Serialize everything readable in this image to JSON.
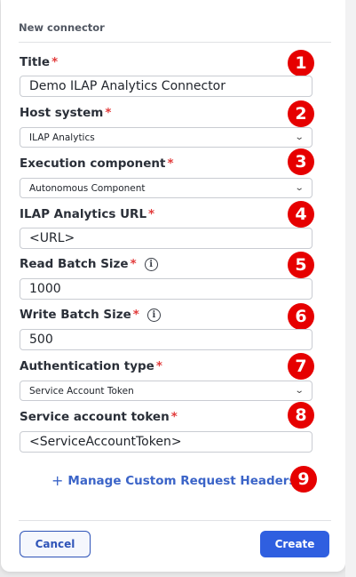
{
  "dialog": {
    "title": "New connector",
    "fields": [
      {
        "label": "Title",
        "required": "*",
        "value": "Demo ILAP Analytics Connector",
        "badge": "1"
      },
      {
        "label": "Host system",
        "required": "*",
        "value": "ILAP Analytics",
        "badge": "2"
      },
      {
        "label": "Execution component",
        "required": "*",
        "value": "Autonomous Component",
        "badge": "3"
      },
      {
        "label": "ILAP Analytics URL",
        "required": "*",
        "value": "<URL>",
        "badge": "4"
      },
      {
        "label": "Read Batch Size",
        "required": "*",
        "value": "1000",
        "badge": "5"
      },
      {
        "label": "Write Batch Size",
        "required": "*",
        "value": "500",
        "badge": "6"
      },
      {
        "label": "Authentication type",
        "required": "*",
        "value": "Service Account Token",
        "badge": "7"
      },
      {
        "label": "Service account token",
        "required": "*",
        "value": "<ServiceAccountToken>",
        "badge": "8"
      }
    ],
    "manage_headers": {
      "plus": "+",
      "label": "Manage Custom Request Headers",
      "badge": "9"
    },
    "info_glyph": "i",
    "chevron": "⌄",
    "buttons": {
      "cancel": "Cancel",
      "create": "Create"
    }
  },
  "colors": {
    "required": "#e23b3b",
    "badge": "#e60000",
    "link": "#3b64c8",
    "primary": "#2f5fe0"
  }
}
